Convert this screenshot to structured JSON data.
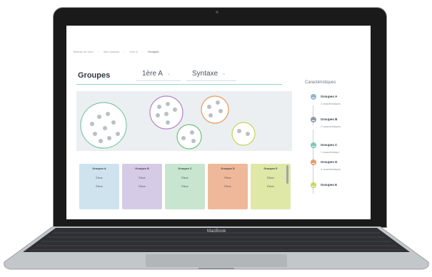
{
  "device": {
    "brand": "MacBook"
  },
  "breadcrumb": [
    "Tableau de bord",
    "Mes classes",
    "1ère A",
    "Groupes"
  ],
  "header": {
    "title": "Groupes",
    "class_select": "1ère A",
    "topic_select": "Syntaxe"
  },
  "sidebar": {
    "title": "Caractéristiques",
    "groups": [
      {
        "name": "Groupes A",
        "sub": "3 caractéristiques",
        "color": "#8fb6cf"
      },
      {
        "name": "Groupes B",
        "sub": "2 caractéristiques",
        "color": "#8f9ca8"
      },
      {
        "name": "Groupes C",
        "sub": "1 caractéristique",
        "color": "#7fc6b8"
      },
      {
        "name": "Groupes D",
        "sub": "4 caractéristiques",
        "color": "#e69b6a"
      },
      {
        "name": "Groupes E",
        "sub": "",
        "color": "#c5d95e"
      }
    ]
  },
  "cards": [
    {
      "title": "Groupes A",
      "rows": [
        "Élève",
        "Élève"
      ],
      "color": "#cfe3ef"
    },
    {
      "title": "Groupes B",
      "rows": [
        "Élève",
        "Élève"
      ],
      "color": "#d6cbe6"
    },
    {
      "title": "Groupes C",
      "rows": [
        "Élève",
        "Élève"
      ],
      "color": "#c8e5cf"
    },
    {
      "title": "Groupes D",
      "rows": [
        "Élève",
        "Élève"
      ],
      "color": "#f0b89a"
    },
    {
      "title": "Groupes E",
      "rows": [
        "Élève",
        "Élève"
      ],
      "color": "#dfe8a6"
    }
  ],
  "bubble_colors": {
    "large": "#7cc8a8",
    "purple": "#b482c8",
    "orange": "#e79a5c",
    "green": "#6ec17a",
    "lime": "#c2d45a"
  }
}
